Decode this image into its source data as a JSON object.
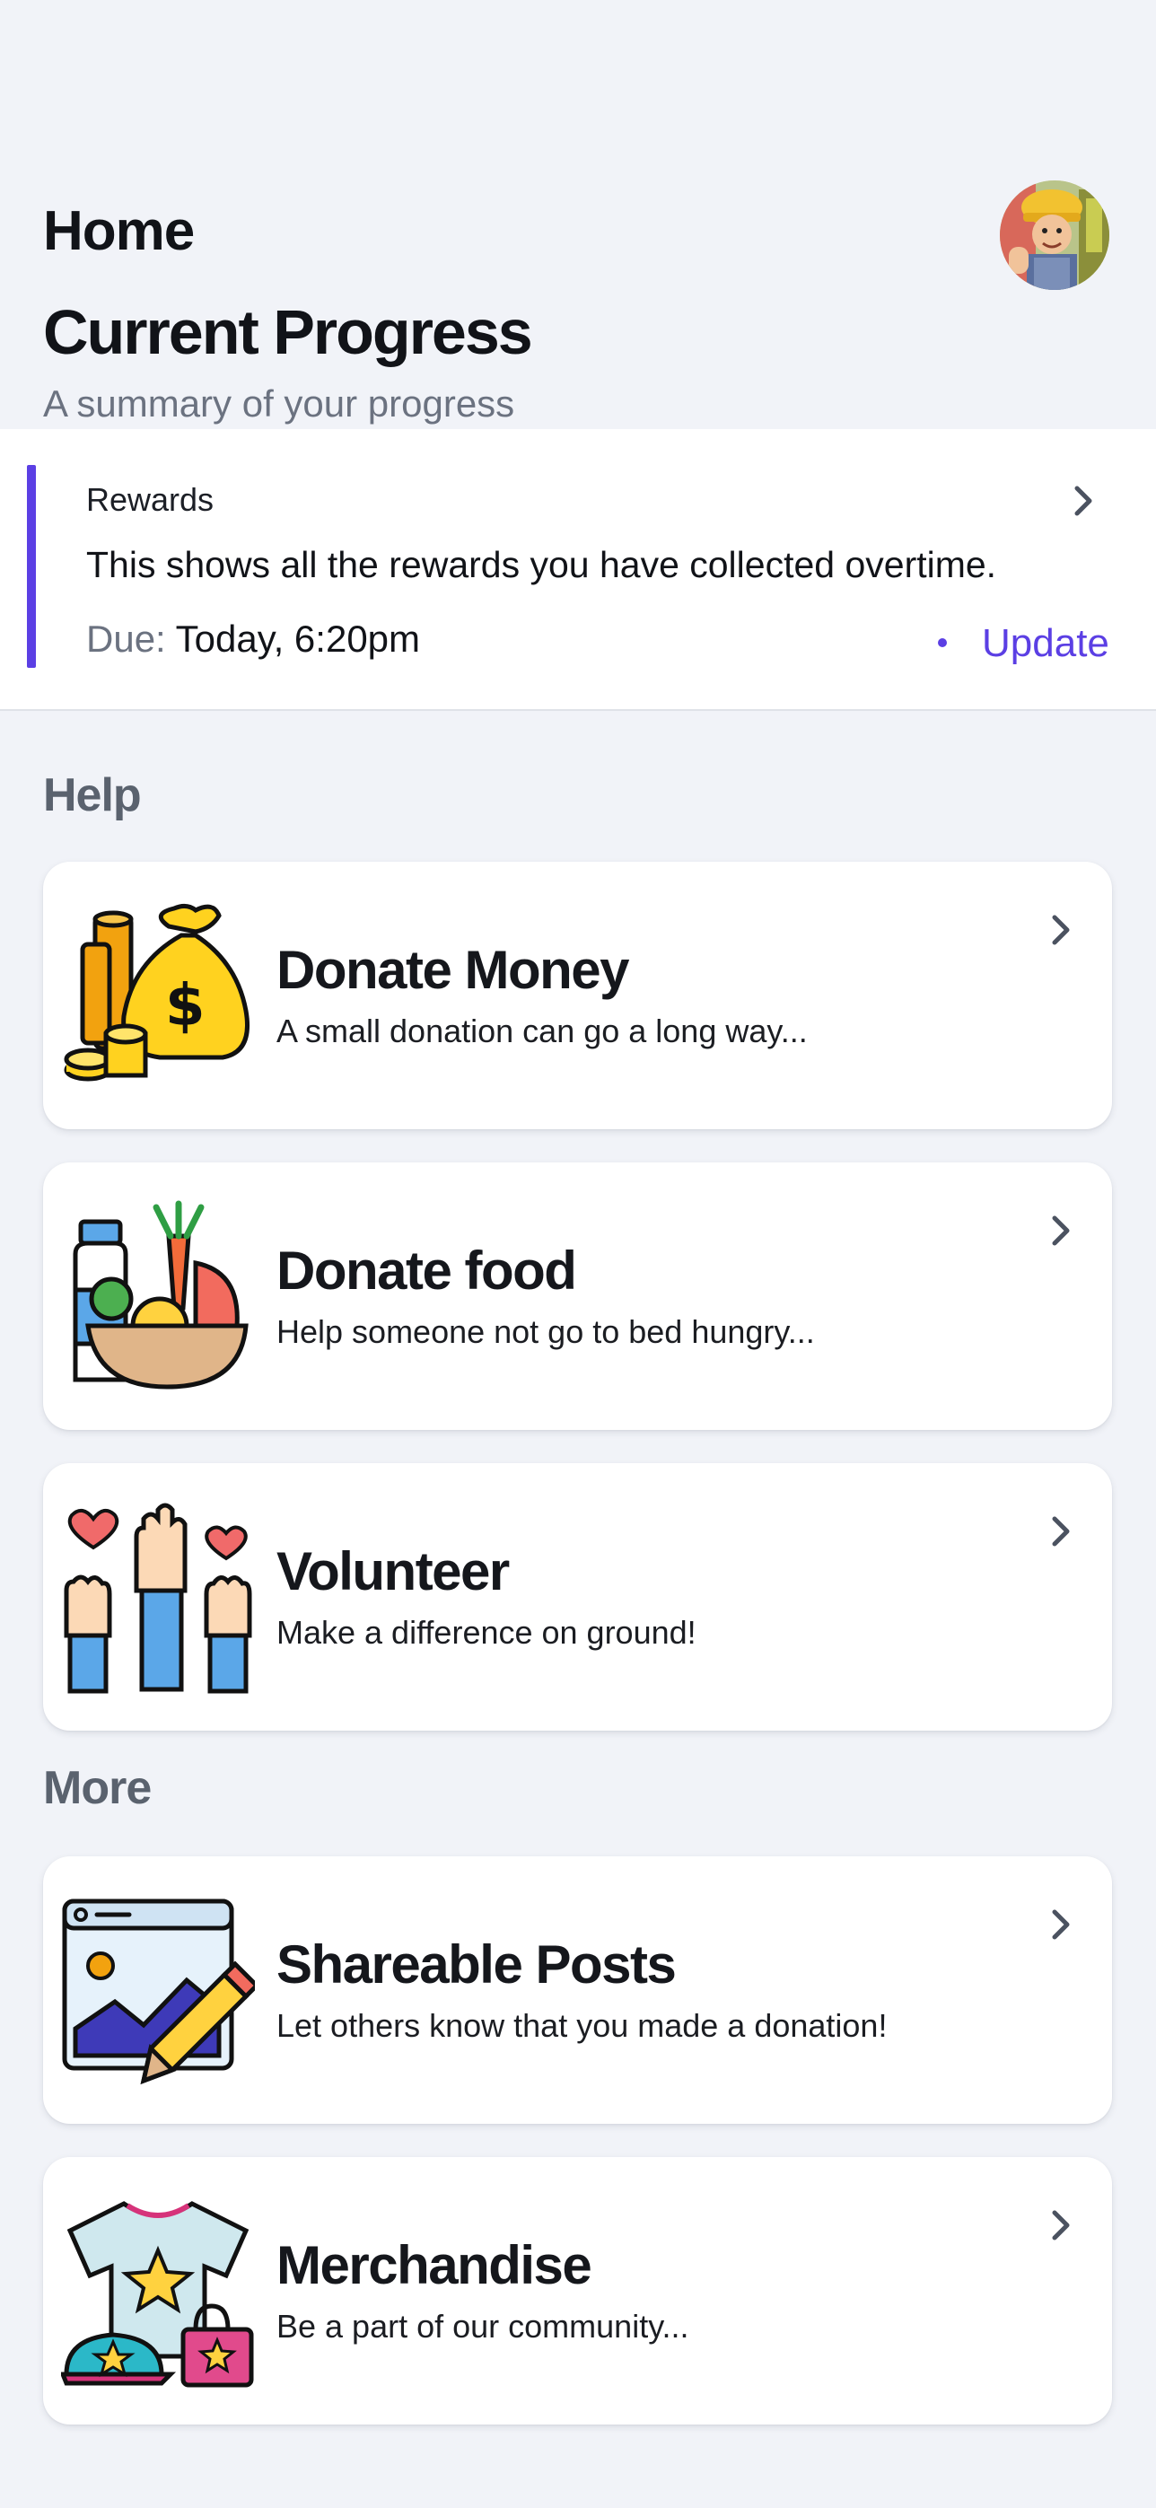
{
  "header": {
    "title": "Home",
    "avatar_icon": "user-avatar"
  },
  "progress": {
    "title": "Current Progress",
    "subtitle": "A summary of your progress"
  },
  "rewards": {
    "label": "Rewards",
    "description": "This shows all the rewards you have collected overtime.",
    "due_label": "Due:",
    "due_value": "Today, 6:20pm",
    "update_label": "Update",
    "accent_color": "#5b3fe4"
  },
  "help_section": {
    "heading": "Help",
    "cards": [
      {
        "title": "Donate Money",
        "subtitle": "A small donation can go a long way...",
        "icon": "money-bag-icon"
      },
      {
        "title": "Donate food",
        "subtitle": "Help someone not go to bed hungry...",
        "icon": "food-basket-icon"
      },
      {
        "title": "Volunteer",
        "subtitle": "Make a difference on ground!",
        "icon": "raised-hands-icon"
      }
    ]
  },
  "more_section": {
    "heading": "More",
    "cards": [
      {
        "title": "Shareable Posts",
        "subtitle": "Let others know that you made a donation!",
        "icon": "image-edit-icon"
      },
      {
        "title": "Merchandise",
        "subtitle": "Be a part of our community...",
        "icon": "merch-icon"
      }
    ]
  }
}
